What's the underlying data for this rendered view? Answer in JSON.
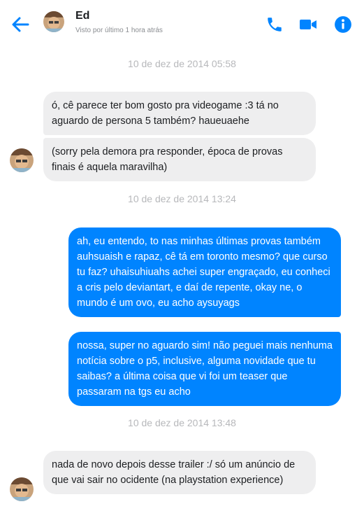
{
  "header": {
    "contact_name": "Ed",
    "status": "Visto por último 1 hora atrás",
    "back_icon": "arrow-left-icon",
    "call_icon": "phone-icon",
    "video_icon": "video-camera-icon",
    "info_icon": "info-icon"
  },
  "colors": {
    "accent": "#0084ff",
    "incoming_bubble": "#eeeeef",
    "timestamp": "#b7b8bb"
  },
  "timestamps": [
    "10 de dez de 2014 05:58",
    "10 de dez de 2014 13:24",
    "10 de dez de 2014 13:48"
  ],
  "messages": [
    {
      "sender": "Ed",
      "text": "ó, cê parece ter bom gosto pra videogame :3 tá no aguardo de persona 5 também? haueuaehe"
    },
    {
      "sender": "Ed",
      "text": "(sorry pela demora pra responder, época de provas finais é aquela maravilha)"
    },
    {
      "sender": "me",
      "text": "ah, eu entendo, to nas minhas últimas provas também auhsuaish e rapaz, cê tá em toronto mesmo? que curso tu faz? uhaisuhiuahs achei super engraçado, eu conheci a cris pelo deviantart, e daí de repente, okay ne, o mundo é um ovo, eu acho aysuyags"
    },
    {
      "sender": "me",
      "text": "nossa, super no aguardo sim! não peguei mais nenhuma notícia sobre o p5, inclusive, alguma novidade que tu saibas? a última coisa que vi foi um teaser que passaram na tgs eu acho"
    },
    {
      "sender": "Ed",
      "text": "nada de novo depois desse trailer :/ só um anúncio de que vai sair no ocidente (na playstation experience)"
    }
  ]
}
